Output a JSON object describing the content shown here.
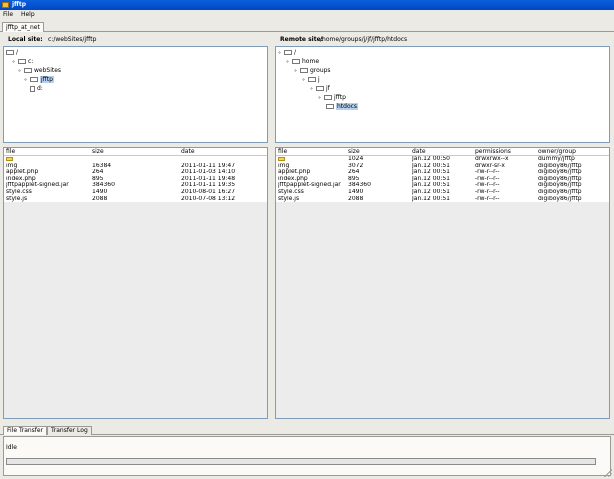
{
  "window": {
    "title": "jfftp"
  },
  "menu": [
    {
      "label": "File"
    },
    {
      "label": "Help"
    }
  ],
  "site_tab": "jfftp_at_net",
  "local": {
    "header_label": "Local site:",
    "path": "c:/webSites/jfftp",
    "tree": [
      {
        "label": "/",
        "toggle": "",
        "kind": "folder"
      },
      {
        "label": "c:",
        "toggle": "∘",
        "kind": "folder"
      },
      {
        "label": "webSites",
        "toggle": "∘",
        "kind": "folder"
      },
      {
        "label": "jfftp",
        "toggle": "∘",
        "kind": "folder",
        "selected": true
      },
      {
        "label": "d:",
        "toggle": "",
        "kind": "file"
      }
    ],
    "columns": [
      "file",
      "size",
      "date"
    ],
    "rows": [
      {
        "file": "..",
        "size": "",
        "date": "",
        "folder": true
      },
      {
        "file": "img",
        "size": "16384",
        "date": "2011-01-11 19:47"
      },
      {
        "file": "applet.php",
        "size": "264",
        "date": "2011-01-03 14:10"
      },
      {
        "file": "index.php",
        "size": "895",
        "date": "2011-01-11 19:48"
      },
      {
        "file": "jfftpapplet-signed.jar",
        "size": "384360",
        "date": "2011-01-11 19:35"
      },
      {
        "file": "style.css",
        "size": "1490",
        "date": "2010-08-01 16:27"
      },
      {
        "file": "style.js",
        "size": "2088",
        "date": "2010-07-08 13:12"
      }
    ]
  },
  "remote": {
    "header_label": "Remote site:",
    "path": "/home/groups/j/jf/jfftp/htdocs",
    "tree": [
      {
        "label": "/",
        "toggle": "∘",
        "kind": "folder"
      },
      {
        "label": "home",
        "toggle": "∘",
        "kind": "folder"
      },
      {
        "label": "groups",
        "toggle": "∘",
        "kind": "folder"
      },
      {
        "label": "j",
        "toggle": "∘",
        "kind": "folder"
      },
      {
        "label": "jf",
        "toggle": "∘",
        "kind": "folder"
      },
      {
        "label": "jfftp",
        "toggle": "∘",
        "kind": "folder"
      },
      {
        "label": "htdocs",
        "toggle": "",
        "kind": "folder",
        "selected": true
      }
    ],
    "columns": [
      "file",
      "size",
      "date",
      "permissions",
      "owner/group"
    ],
    "rows": [
      {
        "file": "..",
        "size": "1024",
        "date": "Jan.12 00:50",
        "permissions": "drwxrwx--x",
        "owner": "dummy/jfftp",
        "folder": true
      },
      {
        "file": "img",
        "size": "3072",
        "date": "Jan.12 00:51",
        "permissions": "drwxr-sr-x",
        "owner": "digiboy86/jfftp"
      },
      {
        "file": "applet.php",
        "size": "264",
        "date": "Jan.12 00:51",
        "permissions": "-rw-r--r--",
        "owner": "digiboy86/jfftp"
      },
      {
        "file": "index.php",
        "size": "895",
        "date": "Jan.12 00:51",
        "permissions": "-rw-r--r--",
        "owner": "digiboy86/jfftp"
      },
      {
        "file": "jfftpapplet-signed.jar",
        "size": "384360",
        "date": "Jan.12 00:51",
        "permissions": "-rw-r--r--",
        "owner": "digiboy86/jfftp"
      },
      {
        "file": "style.css",
        "size": "1490",
        "date": "Jan.12 00:51",
        "permissions": "-rw-r--r--",
        "owner": "digiboy86/jfftp"
      },
      {
        "file": "style.js",
        "size": "2088",
        "date": "Jan.12 00:51",
        "permissions": "-rw-r--r--",
        "owner": "digiboy86/jfftp"
      }
    ]
  },
  "bottom_tabs": [
    {
      "label": "File Transfer",
      "active": true
    },
    {
      "label": "Transfer Log",
      "active": false
    }
  ],
  "transfer": {
    "status": "Idle",
    "progress": 0
  },
  "colors": {
    "titlebar": "#0a5fdc",
    "selection": "#b7d0ee",
    "folder": "#f6d55c"
  }
}
